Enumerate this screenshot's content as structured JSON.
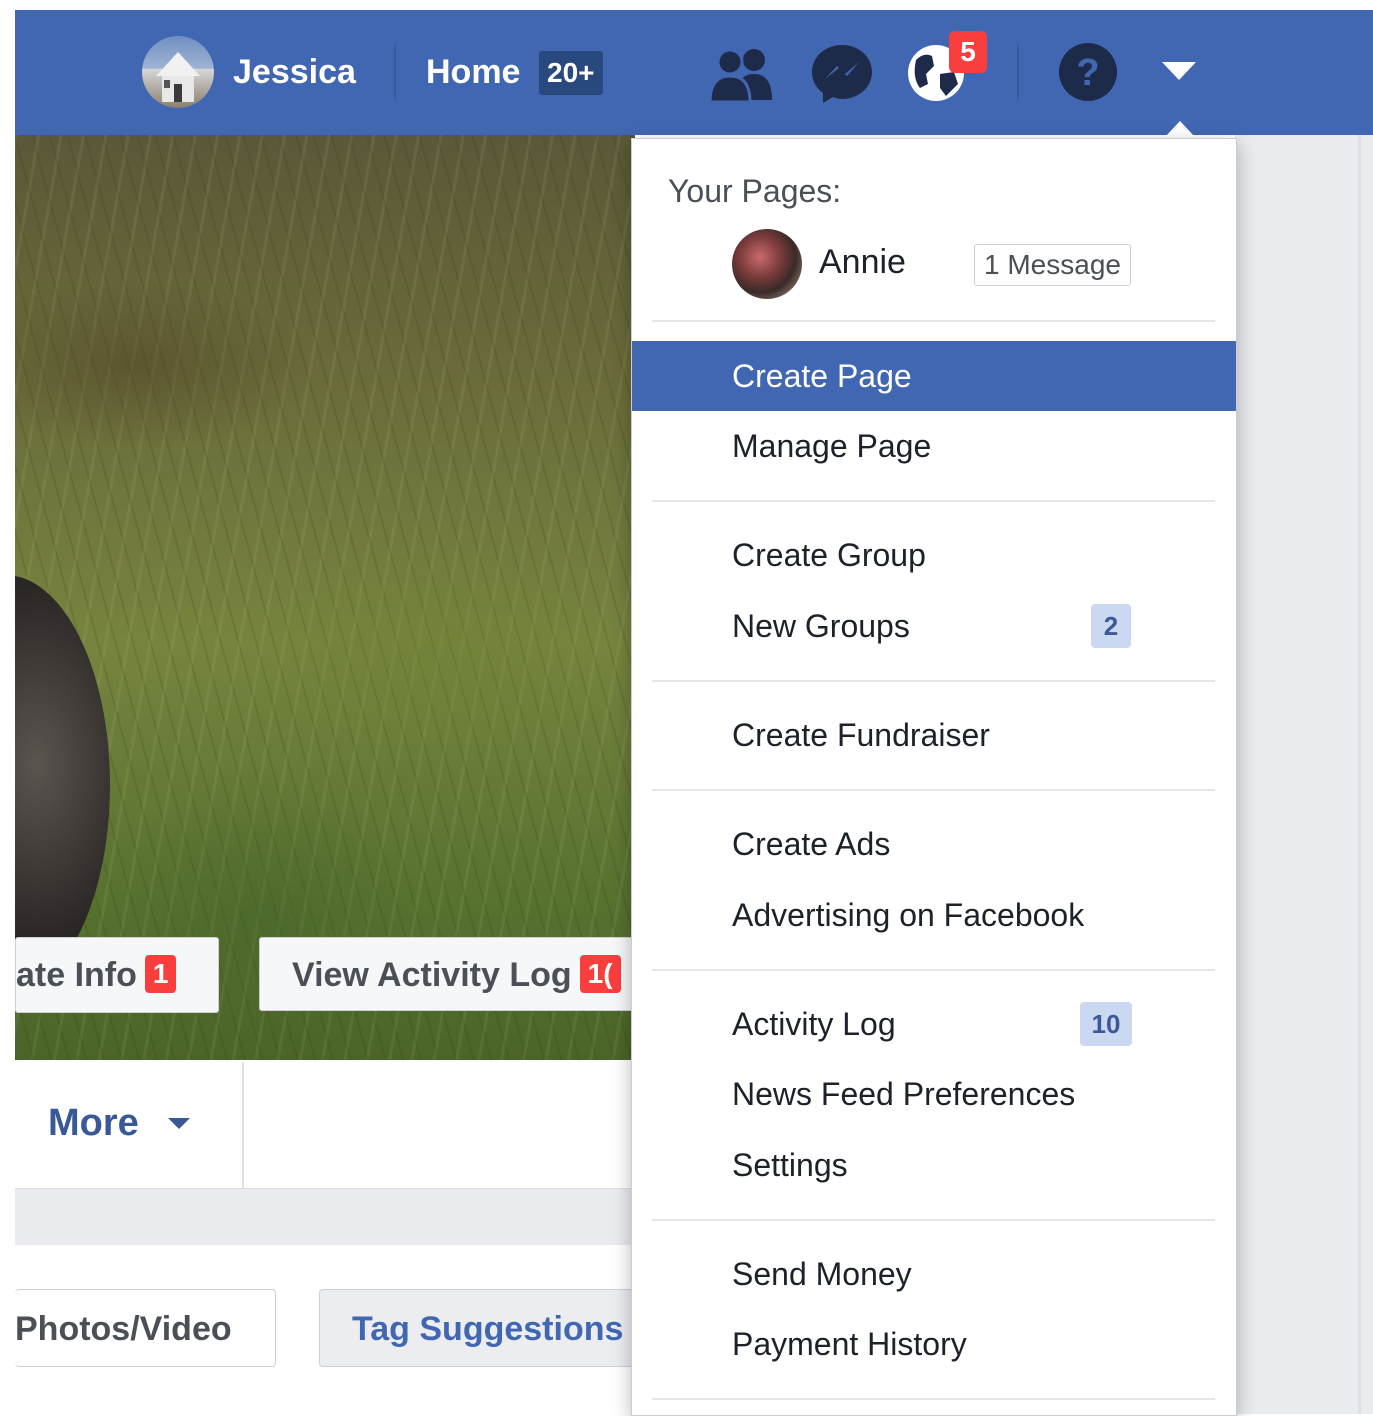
{
  "topbar": {
    "user_name": "Jessica",
    "home_label": "Home",
    "home_count": "20+",
    "notifications_count": "5"
  },
  "cover": {
    "update_info_label": "ate Info",
    "update_info_badge": "1",
    "view_activity_log_label": "View Activity Log",
    "view_activity_log_badge": "1("
  },
  "profile_tabs": {
    "more_label": "More"
  },
  "composer": {
    "photos_label": "Photos/Video",
    "tag_suggestions_label": "Tag Suggestions"
  },
  "menu": {
    "your_pages_heading": "Your Pages:",
    "page_name": "Annie",
    "page_message": "1 Message",
    "items": [
      {
        "label": "Create Page"
      },
      {
        "label": "Manage Page"
      },
      {
        "label": "Create Group"
      },
      {
        "label": "New Groups",
        "badge": "2"
      },
      {
        "label": "Create Fundraiser"
      },
      {
        "label": "Create Ads"
      },
      {
        "label": "Advertising on Facebook"
      },
      {
        "label": "Activity Log",
        "badge": "10"
      },
      {
        "label": "News Feed Preferences"
      },
      {
        "label": "Settings"
      },
      {
        "label": "Send Money"
      },
      {
        "label": "Payment History"
      }
    ]
  },
  "icons": {
    "friends": "friend-requests-icon",
    "messenger": "messenger-icon",
    "notifications": "globe-notifications-icon",
    "help": "help-question-icon",
    "account_menu": "caret-down-icon"
  },
  "colors": {
    "brand_blue": "#4267b2",
    "highlight": "#4267b2",
    "badge_red": "#fa3e3e",
    "count_badge_bg": "#cad8f2",
    "link_blue": "#385898"
  }
}
